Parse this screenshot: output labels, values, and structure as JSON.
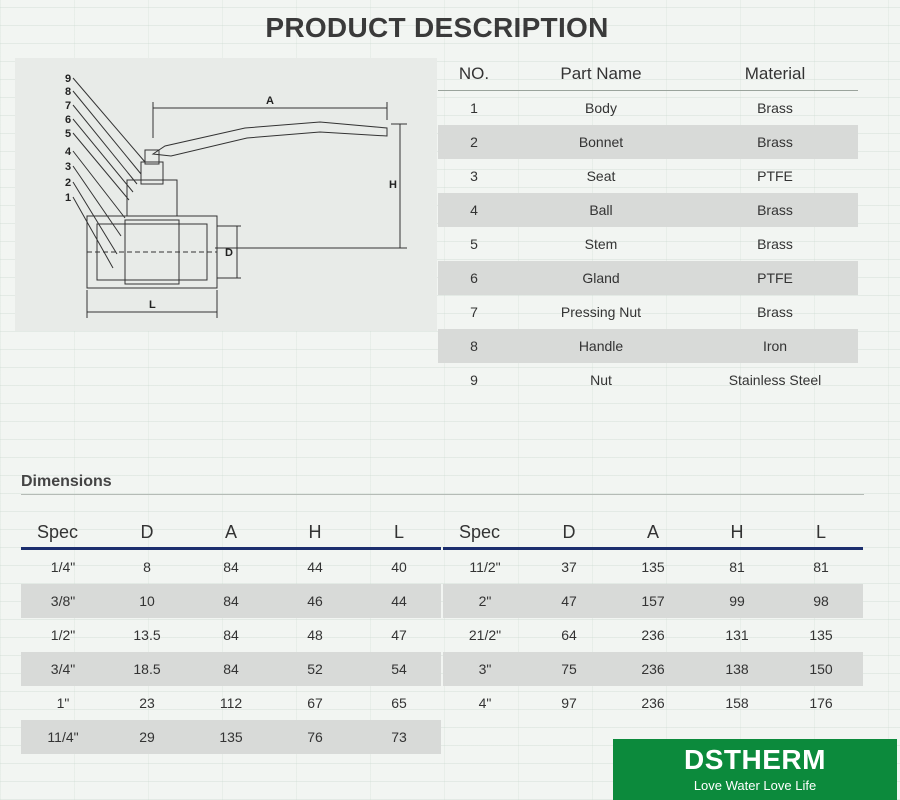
{
  "title": "PRODUCT DESCRIPTION",
  "diagram": {
    "part_numbers": [
      "9",
      "8",
      "7",
      "6",
      "5",
      "4",
      "3",
      "2",
      "1"
    ],
    "dimension_labels": {
      "a": "A",
      "h": "H",
      "d": "D",
      "l": "L"
    }
  },
  "parts_table": {
    "headers": {
      "no": "NO.",
      "name": "Part Name",
      "material": "Material"
    },
    "rows": [
      {
        "no": "1",
        "name": "Body",
        "material": "Brass"
      },
      {
        "no": "2",
        "name": "Bonnet",
        "material": "Brass"
      },
      {
        "no": "3",
        "name": "Seat",
        "material": "PTFE"
      },
      {
        "no": "4",
        "name": "Ball",
        "material": "Brass"
      },
      {
        "no": "5",
        "name": "Stem",
        "material": "Brass"
      },
      {
        "no": "6",
        "name": "Gland",
        "material": "PTFE"
      },
      {
        "no": "7",
        "name": "Pressing Nut",
        "material": "Brass"
      },
      {
        "no": "8",
        "name": "Handle",
        "material": "Iron"
      },
      {
        "no": "9",
        "name": "Nut",
        "material": "Stainless Steel"
      }
    ]
  },
  "dimensions": {
    "title": "Dimensions",
    "headers": [
      "Spec",
      "D",
      "A",
      "H",
      "L"
    ],
    "left_rows": [
      [
        "1/4\"",
        "8",
        "84",
        "44",
        "40"
      ],
      [
        "3/8\"",
        "10",
        "84",
        "46",
        "44"
      ],
      [
        "1/2\"",
        "13.5",
        "84",
        "48",
        "47"
      ],
      [
        "3/4\"",
        "18.5",
        "84",
        "52",
        "54"
      ],
      [
        "1\"",
        "23",
        "112",
        "67",
        "65"
      ],
      [
        "11/4\"",
        "29",
        "135",
        "76",
        "73"
      ]
    ],
    "right_rows": [
      [
        "11/2\"",
        "37",
        "135",
        "81",
        "81"
      ],
      [
        "2\"",
        "47",
        "157",
        "99",
        "98"
      ],
      [
        "21/2\"",
        "64",
        "236",
        "131",
        "135"
      ],
      [
        "3\"",
        "75",
        "236",
        "138",
        "150"
      ],
      [
        "4\"",
        "97",
        "236",
        "158",
        "176"
      ]
    ]
  },
  "logo": {
    "brand": "DSTHERM",
    "tagline": "Love Water Love Life"
  },
  "colors": {
    "header_rule": "#1c2e6e",
    "logo_green": "#0c8a3c",
    "row_shade": "#d8dad8"
  }
}
